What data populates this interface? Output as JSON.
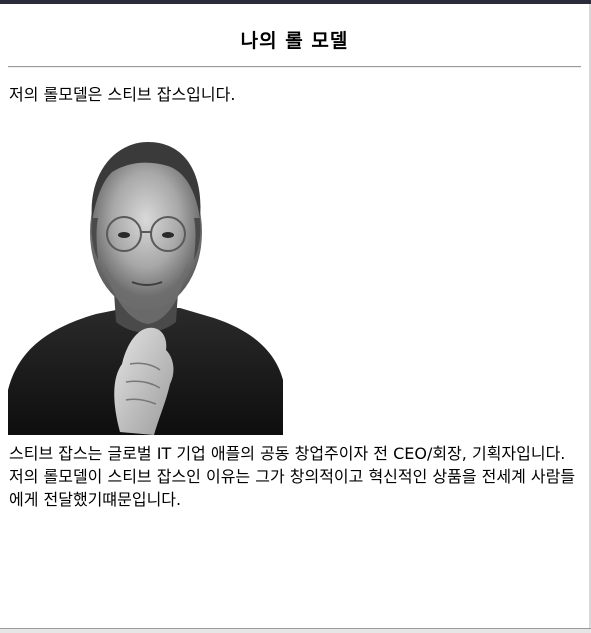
{
  "header": {
    "title": "나의 롤 모델"
  },
  "intro": "저의 롤모델은 스티브 잡스입니다.",
  "photo": {
    "alt": "스티브 잡스"
  },
  "description": {
    "line1": "스티브 잡스는 글로벌 IT 기업 애플의 공동 창업주이자 전 CEO/회장, 기획자입니다.",
    "line2": "저의 롤모델이 스티브 잡스인 이유는 그가 창의적이고 혁신적인 상품을 전세계 사람들에게 전달했기떄문입니다."
  },
  "colors": {
    "text": "#000000",
    "rule": "#9a9a9a",
    "background": "#ffffff"
  }
}
